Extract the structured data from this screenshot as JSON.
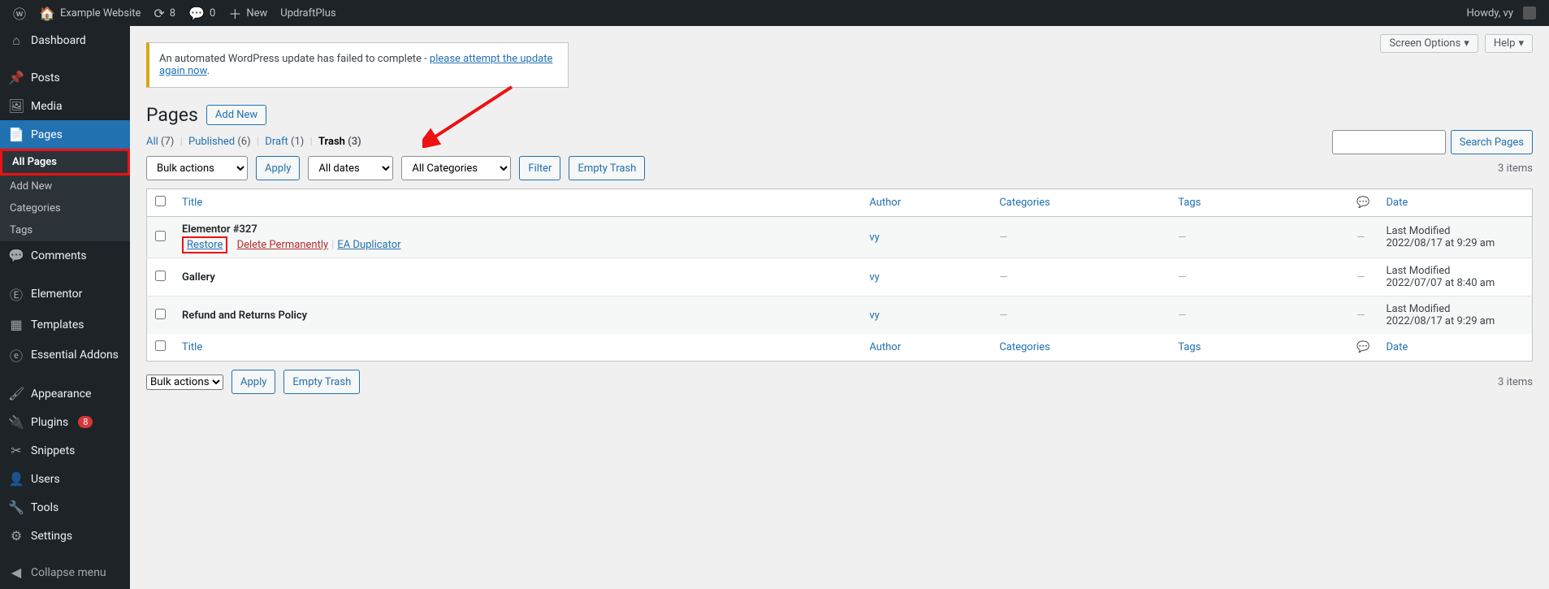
{
  "adminbar": {
    "site_name": "Example Website",
    "updates": "8",
    "comments": "0",
    "new": "New",
    "updraft": "UpdraftPlus",
    "howdy": "Howdy, vy"
  },
  "sidebar": {
    "dashboard": "Dashboard",
    "posts": "Posts",
    "media": "Media",
    "pages": "Pages",
    "all_pages": "All Pages",
    "add_new": "Add New",
    "categories": "Categories",
    "tags": "Tags",
    "comments": "Comments",
    "elementor": "Elementor",
    "templates": "Templates",
    "essential_addons": "Essential Addons",
    "appearance": "Appearance",
    "plugins": "Plugins",
    "plugins_badge": "8",
    "snippets": "Snippets",
    "users": "Users",
    "tools": "Tools",
    "settings": "Settings",
    "collapse": "Collapse menu"
  },
  "top_actions": {
    "screen_options": "Screen Options",
    "help": "Help"
  },
  "notice": {
    "text": "An automated WordPress update has failed to complete - ",
    "link": "please attempt the update again now",
    "period": "."
  },
  "header": {
    "title": "Pages",
    "add_new": "Add New"
  },
  "filters": {
    "all": "All",
    "all_count": "(7)",
    "published": "Published",
    "published_count": "(6)",
    "draft": "Draft",
    "draft_count": "(1)",
    "trash": "Trash",
    "trash_count": "(3)"
  },
  "actions": {
    "bulk_label": "Bulk actions",
    "apply": "Apply",
    "all_dates": "All dates",
    "all_categories": "All Categories",
    "filter": "Filter",
    "empty_trash": "Empty Trash",
    "items_count": "3 items",
    "search": "Search Pages"
  },
  "table": {
    "headers": {
      "title": "Title",
      "author": "Author",
      "categories": "Categories",
      "tags": "Tags",
      "date": "Date"
    },
    "rows": [
      {
        "title": "Elementor #327",
        "restore": "Restore",
        "delete": "Delete Permanently",
        "dup": "EA Duplicator",
        "author": "vy",
        "categories": "—",
        "tags": "—",
        "comments": "—",
        "date_label": "Last Modified",
        "date_value": "2022/08/17 at 9:29 am",
        "show_actions": true
      },
      {
        "title": "Gallery",
        "author": "vy",
        "categories": "—",
        "tags": "—",
        "comments": "—",
        "date_label": "Last Modified",
        "date_value": "2022/07/07 at 8:40 am",
        "show_actions": false
      },
      {
        "title": "Refund and Returns Policy",
        "author": "vy",
        "categories": "—",
        "tags": "—",
        "comments": "—",
        "date_label": "Last Modified",
        "date_value": "2022/08/17 at 9:29 am",
        "show_actions": false
      }
    ]
  }
}
